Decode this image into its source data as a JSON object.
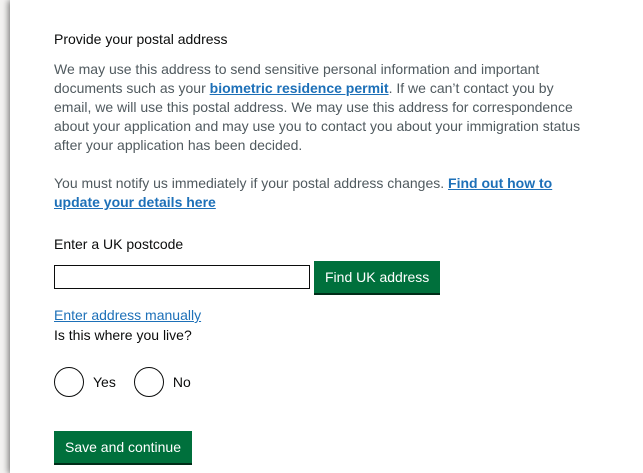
{
  "form": {
    "heading": "Provide your postal address",
    "paragraph1": {
      "before_link": "We may use this address to send sensitive personal information and important documents such as your ",
      "link_text": "biometric residence permit",
      "after_link": ". If we can’t contact you by email, we will use this postal address. We may use this address for correspondence about your application and may use you to contact you about your immigration status after your application has been decided."
    },
    "paragraph2": {
      "before_link": "You must notify us immediately if your postal address changes. ",
      "link_text": "Find out how to update your details here"
    },
    "postcode": {
      "label": "Enter a UK postcode",
      "value": "",
      "find_button": "Find UK address"
    },
    "manual_link": "Enter address manually",
    "live_question": {
      "label": "Is this where you live?",
      "options": [
        "Yes",
        "No"
      ],
      "selected": null
    },
    "save_button": "Save and continue"
  },
  "colors": {
    "link": "#1d70b8",
    "button": "#00703c",
    "body_text": "#505a5f",
    "text": "#0b0c0c"
  }
}
